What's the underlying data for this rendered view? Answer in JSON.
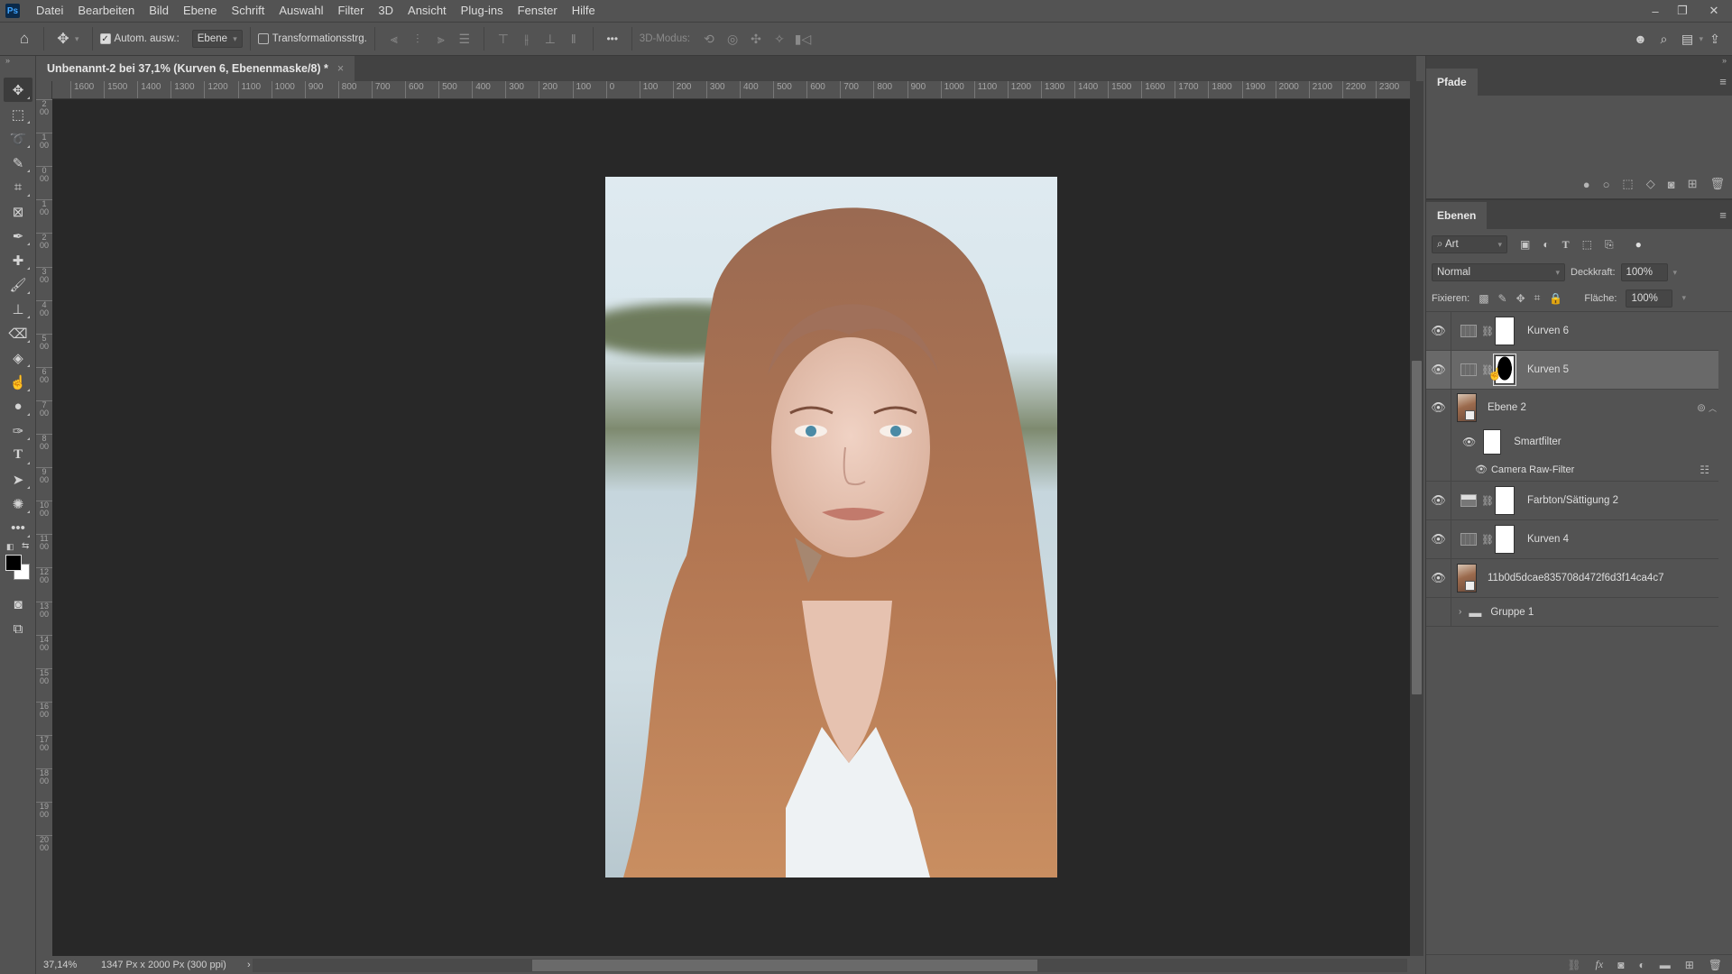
{
  "app": {
    "logo": "Ps"
  },
  "menu": [
    "Datei",
    "Bearbeiten",
    "Bild",
    "Ebene",
    "Schrift",
    "Auswahl",
    "Filter",
    "3D",
    "Ansicht",
    "Plug-ins",
    "Fenster",
    "Hilfe"
  ],
  "window_controls": {
    "minimize": "–",
    "restore": "❐",
    "close": "✕"
  },
  "options_bar": {
    "auto_select_label": "Autom. ausw.:",
    "auto_select_checked": true,
    "auto_select_target": "Ebene",
    "transform_controls_label": "Transformationsstrg.",
    "transform_controls_checked": false,
    "more_label": "•••",
    "mode_3d_label": "3D-Modus:"
  },
  "document": {
    "tab_title": "Unbenannt-2 bei 37,1% (Kurven 6, Ebenenmaske/8) *",
    "close_glyph": "×"
  },
  "ruler_h": [
    "1600",
    "1500",
    "1400",
    "1300",
    "1200",
    "1100",
    "1000",
    "900",
    "800",
    "700",
    "600",
    "500",
    "400",
    "300",
    "200",
    "100",
    "0",
    "100",
    "200",
    "300",
    "400",
    "500",
    "600",
    "700",
    "800",
    "900",
    "1000",
    "1100",
    "1200",
    "1300",
    "1400",
    "1500",
    "1600",
    "1700",
    "1800",
    "1900",
    "2000",
    "2100",
    "2200",
    "2300"
  ],
  "ruler_v": [
    "2",
    "1",
    "0",
    "1",
    "2",
    "3",
    "4",
    "5",
    "6",
    "7",
    "8",
    "9",
    "10",
    "11",
    "12",
    "13",
    "14",
    "15",
    "16",
    "17",
    "18",
    "19",
    "20"
  ],
  "status": {
    "zoom": "37,14%",
    "doc_info": "1347 Px x 2000 Px (300 ppi)",
    "arrow": "›"
  },
  "paths_panel": {
    "tab": "Pfade"
  },
  "layers_panel": {
    "tab": "Ebenen",
    "filter_kind": "Art",
    "blend_mode": "Normal",
    "opacity_label": "Deckkraft:",
    "opacity_value": "100%",
    "lock_label": "Fixieren:",
    "fill_label": "Fläche:",
    "fill_value": "100%",
    "layers": [
      {
        "name": "Kurven 6",
        "type": "curves",
        "visible": true,
        "selected": false
      },
      {
        "name": "Kurven 5",
        "type": "curves",
        "visible": true,
        "selected": true
      },
      {
        "name": "Ebene 2",
        "type": "smart-object",
        "visible": true,
        "selected": false
      },
      {
        "name": "Smartfilter",
        "type": "smart-filter-mask",
        "visible": true
      },
      {
        "name": "Camera Raw-Filter",
        "type": "filter",
        "visible": true
      },
      {
        "name": "Farbton/Sättigung 2",
        "type": "hue-saturation",
        "visible": true,
        "selected": false
      },
      {
        "name": "Kurven 4",
        "type": "curves",
        "visible": true,
        "selected": false
      },
      {
        "name": "11b0d5dcae835708d472f6d3f14ca4c7",
        "type": "smart-object",
        "visible": true,
        "selected": false
      },
      {
        "name": "Gruppe 1",
        "type": "group",
        "visible": false,
        "collapsed": true
      }
    ]
  }
}
